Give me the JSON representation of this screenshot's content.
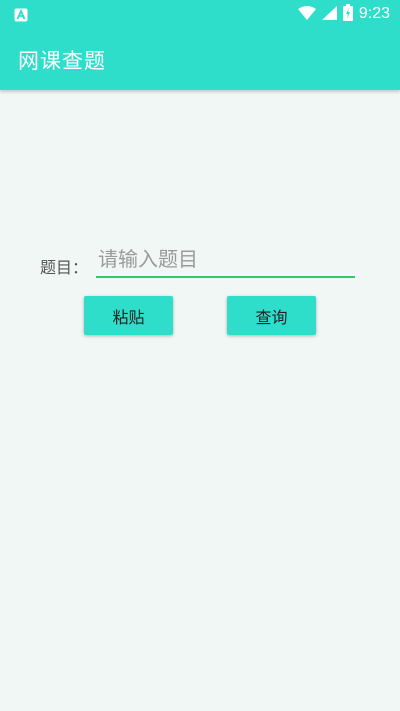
{
  "status_bar": {
    "time": "9:23",
    "left_icon": "app-notification-icon",
    "icons": [
      "wifi-icon",
      "cell-signal-icon",
      "battery-charging-icon"
    ]
  },
  "app_bar": {
    "title": "网课查题"
  },
  "form": {
    "label": "题目：",
    "input_value": "",
    "input_placeholder": "请输入题目"
  },
  "buttons": {
    "paste_label": "粘贴",
    "query_label": "查询"
  },
  "colors": {
    "primary": "#2edecb",
    "background": "#f1f7f5",
    "input_underline": "#2ec96b"
  }
}
